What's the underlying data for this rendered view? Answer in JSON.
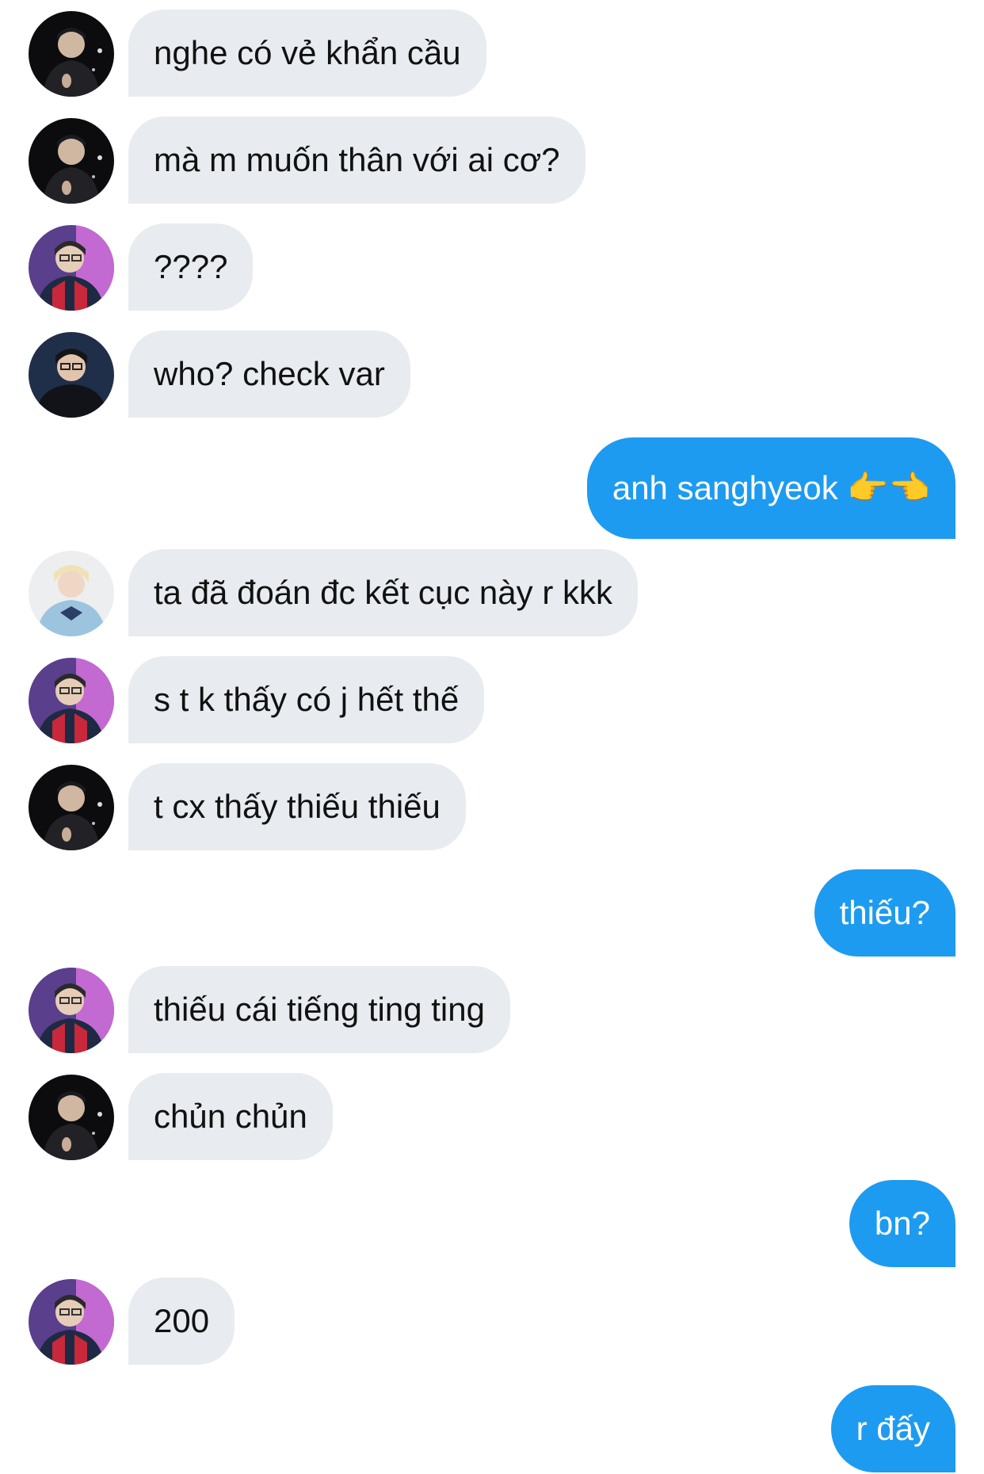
{
  "colors": {
    "incoming_bubble": "#e8ebef",
    "outgoing_bubble": "#1d9bf0",
    "incoming_text": "#111111",
    "outgoing_text": "#ffffff"
  },
  "messages": [
    {
      "direction": "incoming",
      "avatar": "dark-portrait",
      "text": "nghe có vẻ khẩn cầu"
    },
    {
      "direction": "incoming",
      "avatar": "dark-portrait",
      "text": "mà m muốn thân với ai cơ?"
    },
    {
      "direction": "incoming",
      "avatar": "jersey-portrait",
      "text": "????"
    },
    {
      "direction": "incoming",
      "avatar": "hoodie-portrait",
      "text": "who? check var"
    },
    {
      "direction": "outgoing",
      "text": "anh sanghyeok 👉👈"
    },
    {
      "direction": "incoming",
      "avatar": "blond-portrait",
      "text": "ta đã đoán đc kết cục này r kkk"
    },
    {
      "direction": "incoming",
      "avatar": "jersey-portrait",
      "text": "s t k thấy có j hết thế"
    },
    {
      "direction": "incoming",
      "avatar": "dark-portrait",
      "text": "t cx thấy thiếu thiếu"
    },
    {
      "direction": "outgoing",
      "text": "thiếu?"
    },
    {
      "direction": "incoming",
      "avatar": "jersey-portrait",
      "text": "thiếu cái tiếng ting ting"
    },
    {
      "direction": "incoming",
      "avatar": "dark-portrait",
      "text": "chủn chủn"
    },
    {
      "direction": "outgoing",
      "text": "bn?"
    },
    {
      "direction": "incoming",
      "avatar": "jersey-portrait",
      "text": "200"
    },
    {
      "direction": "outgoing",
      "text": "r đấy"
    }
  ]
}
